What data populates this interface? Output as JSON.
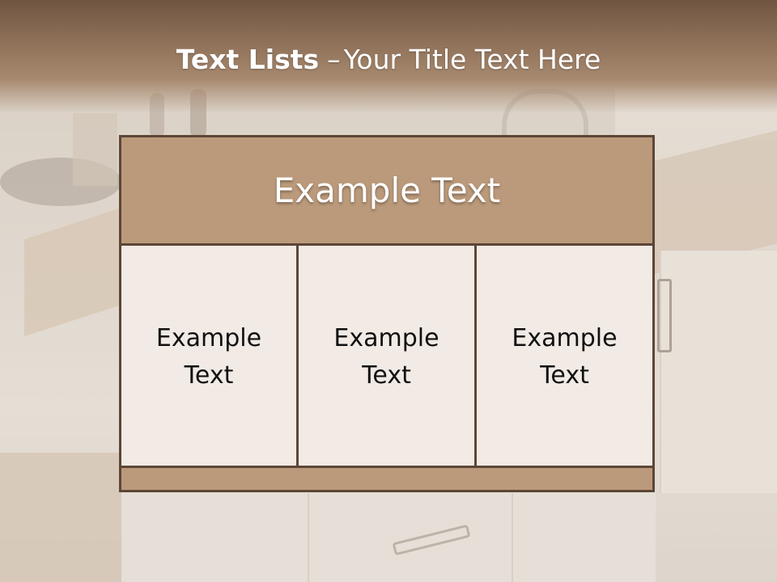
{
  "title": {
    "bold": "Text Lists",
    "separator": "–",
    "rest": "Your Title Text Here"
  },
  "list": {
    "header": "Example Text",
    "items": [
      "Example Text",
      "Example Text",
      "Example Text"
    ]
  },
  "colors": {
    "title_band": "#8d6f57",
    "box_fill": "#bb9a7b",
    "box_border": "#5c4636",
    "cell_fill": "#f1eae5"
  }
}
